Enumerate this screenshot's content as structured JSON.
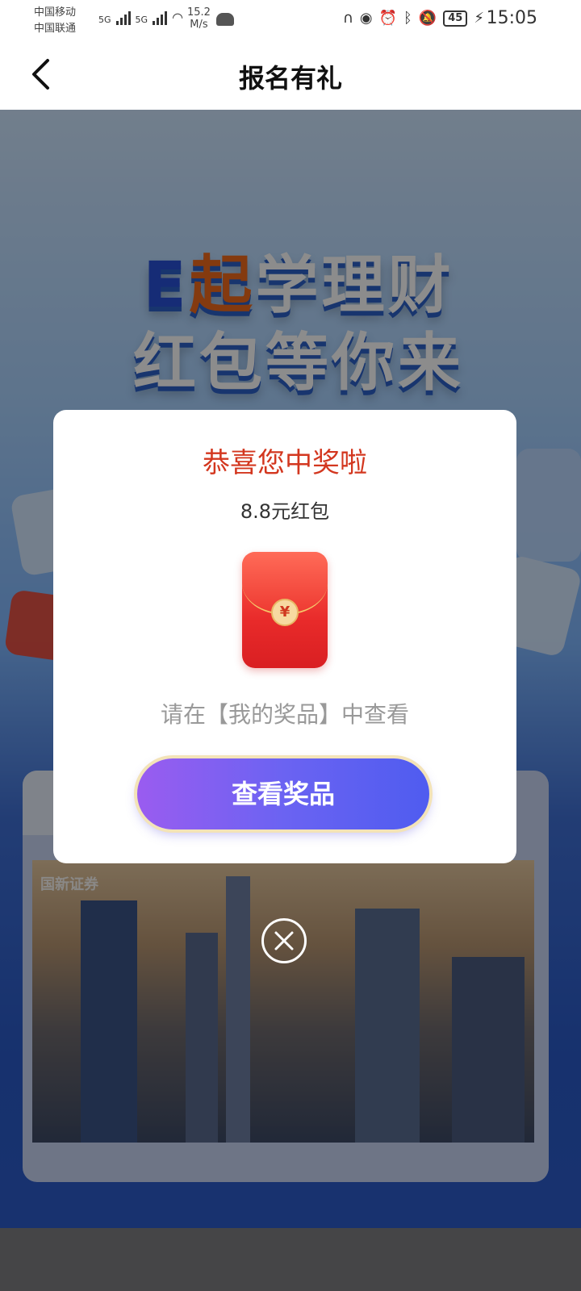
{
  "status_bar": {
    "carrier1": "中国移动",
    "carrier2": "中国联通",
    "net1": "5G",
    "net2": "5G",
    "speed_value": "15.2",
    "speed_unit": "M/s",
    "battery": "45",
    "time": "15:05"
  },
  "nav": {
    "title": "报名有礼"
  },
  "banner": {
    "line1_e": "E",
    "line1_qi": "起",
    "line1_rest": "学理财",
    "line2": "红包等你来"
  },
  "photo": {
    "logo_text": "国新证券"
  },
  "modal": {
    "title": "恭喜您中奖啦",
    "prize": "8.8元红包",
    "envelope_symbol": "¥",
    "hint": "请在【我的奖品】中查看",
    "button_label": "查看奖品"
  },
  "colors": {
    "modal_title": "#d3371f",
    "button_start": "#9a5cf0",
    "button_end": "#4f5cf0",
    "envelope": "#e82a2a"
  }
}
